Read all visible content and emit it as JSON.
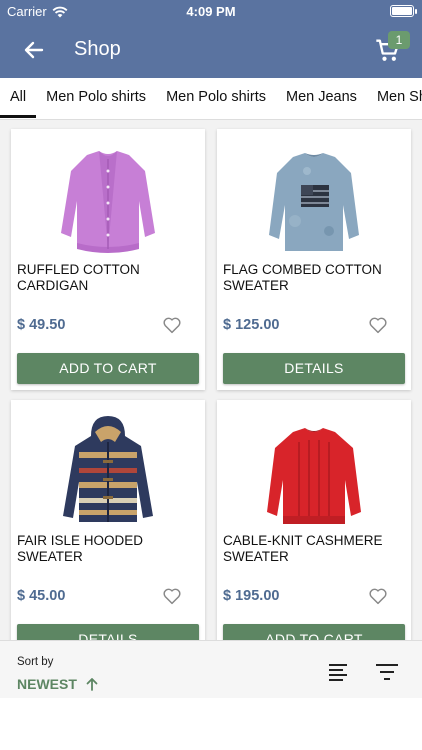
{
  "status": {
    "carrier": "Carrier",
    "time": "4:09 PM"
  },
  "header": {
    "title": "Shop",
    "cart_count": "1"
  },
  "tabs": [
    {
      "label": "All"
    },
    {
      "label": "Men Polo shirts"
    },
    {
      "label": "Men Polo shirts"
    },
    {
      "label": "Men Jeans"
    },
    {
      "label": "Men Shirts"
    }
  ],
  "products": [
    {
      "name": "RUFFLED COTTON CARDIGAN",
      "price": "$ 49.50",
      "action": "ADD TO CART",
      "image": "purple-cardigan",
      "color": "#c77fd6"
    },
    {
      "name": "FLAG COMBED COTTON SWEATER",
      "price": "$ 125.00",
      "action": "DETAILS",
      "image": "flag-sweater",
      "color": "#7e9db8"
    },
    {
      "name": "FAIR ISLE HOODED SWEATER",
      "price": "$ 45.00",
      "action": "DETAILS",
      "image": "fair-isle-hoodie",
      "color": "#2e3a5e"
    },
    {
      "name": "CABLE-KNIT CASHMERE SWEATER",
      "price": "$ 195.00",
      "action": "ADD TO CART",
      "image": "red-sweater",
      "color": "#d8242a"
    }
  ],
  "sort": {
    "label": "Sort by",
    "value": "NEWEST"
  },
  "colors": {
    "header": "#5a73a0",
    "button": "#5d8663",
    "price": "#4f6b91",
    "badge": "#6b9b6e"
  }
}
